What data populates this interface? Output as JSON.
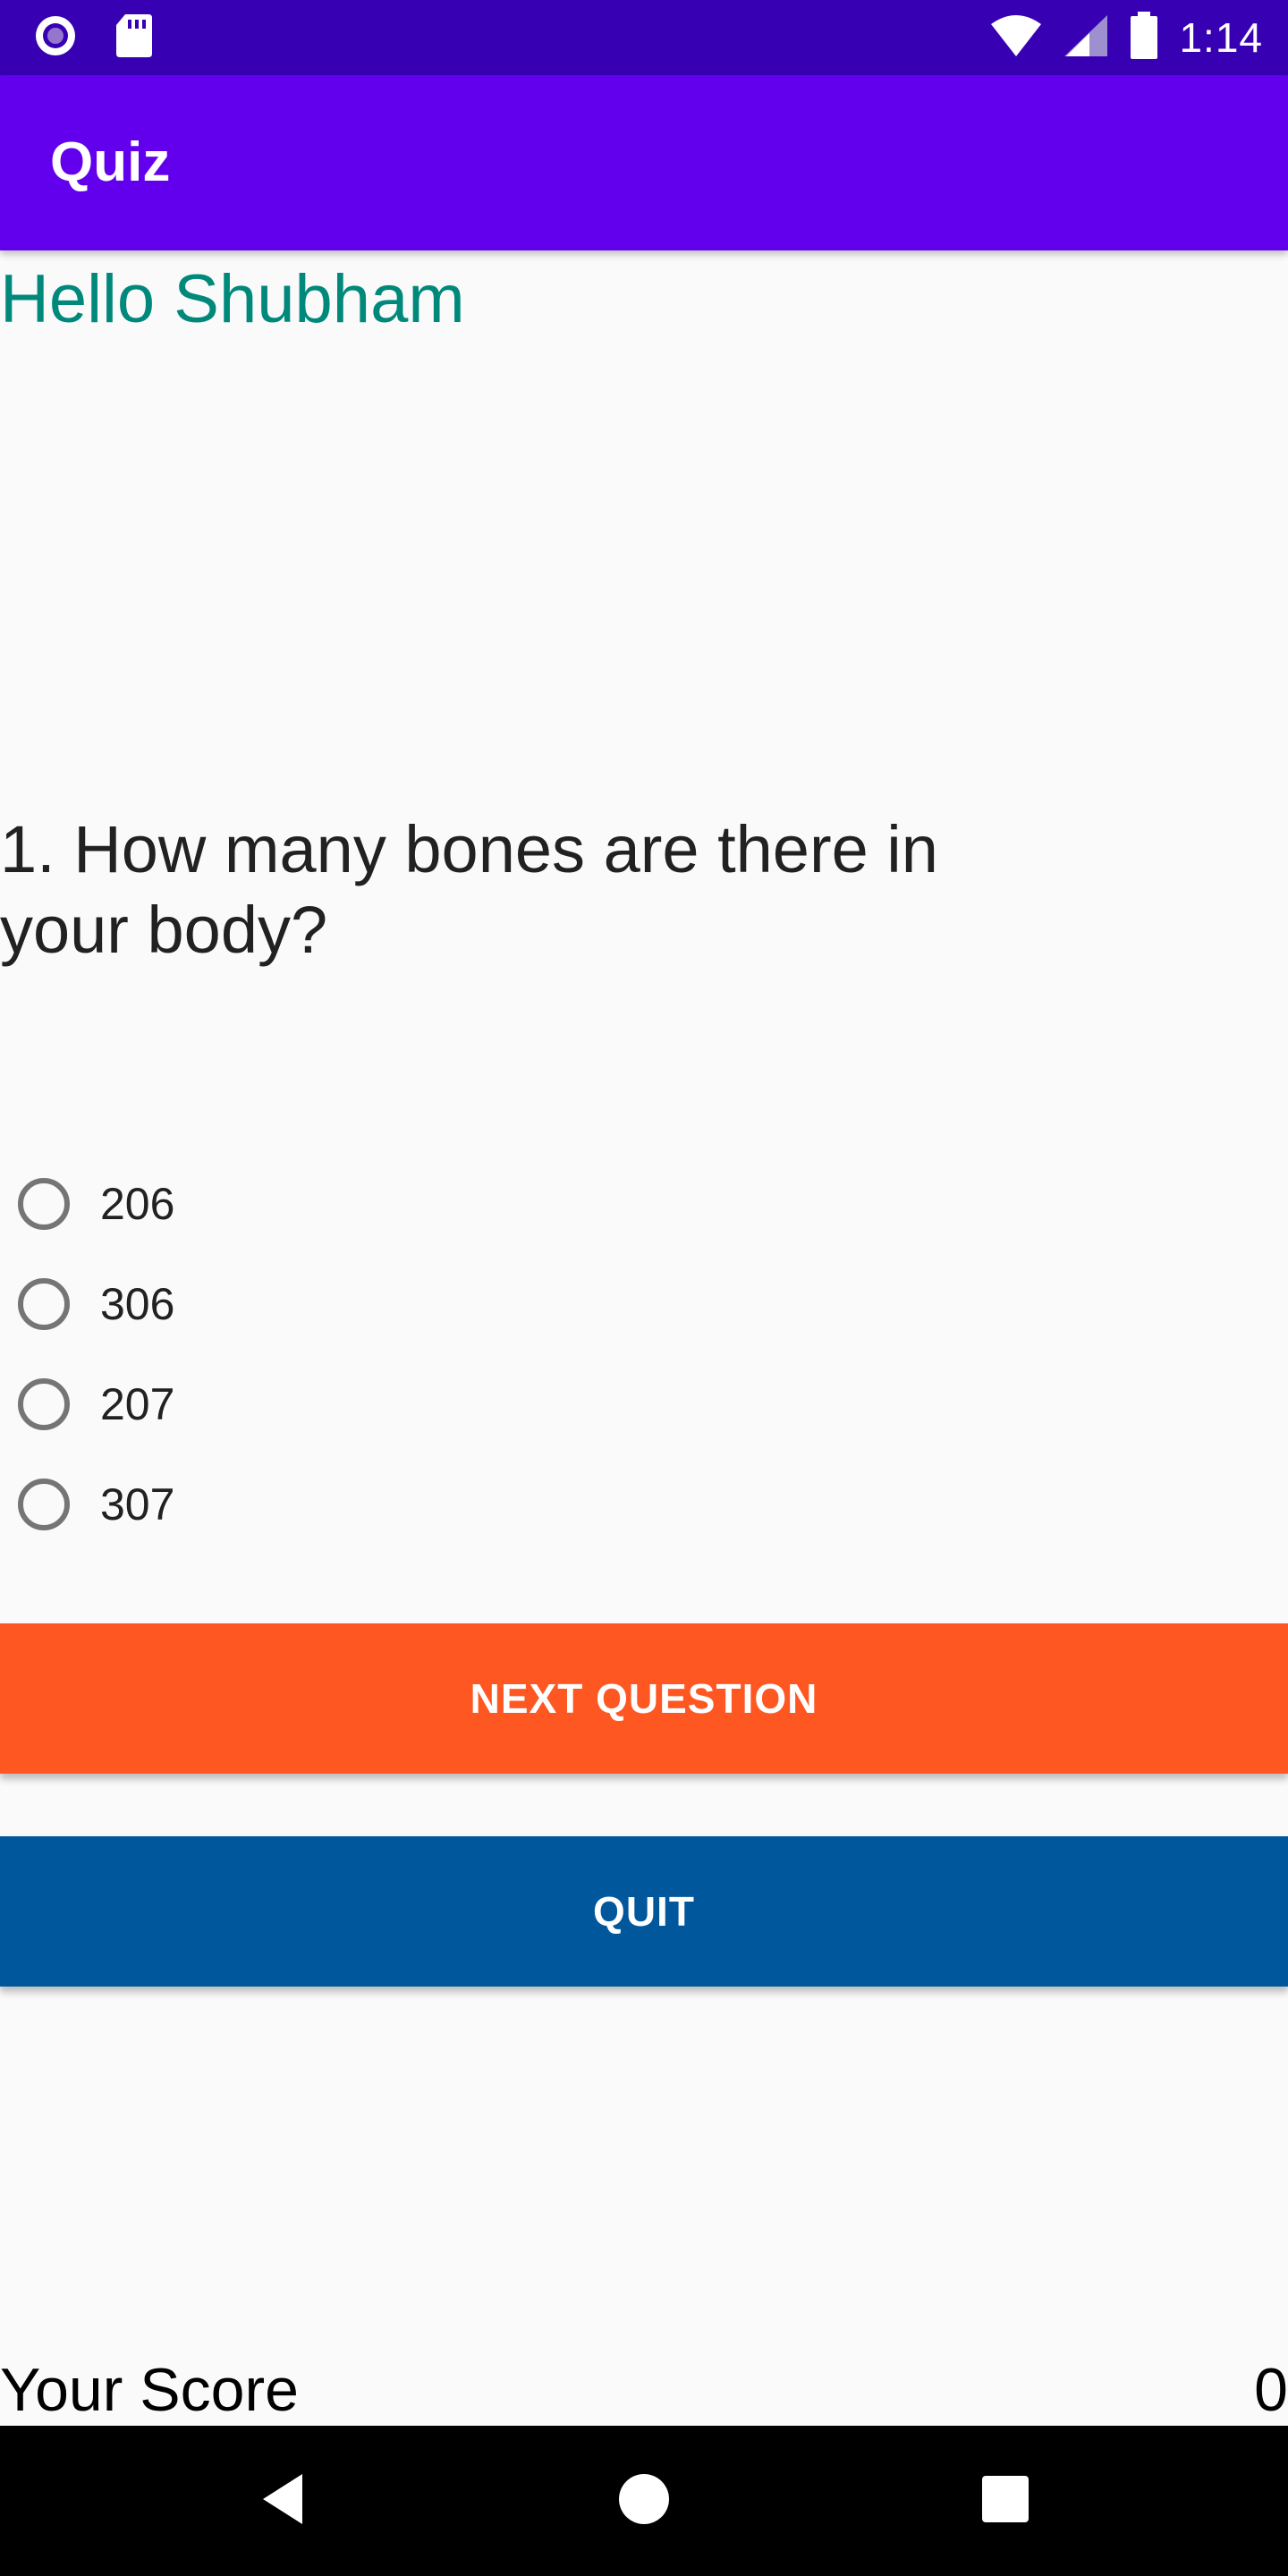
{
  "status_bar": {
    "time": "1:14",
    "left_icons": [
      "record-indicator-icon",
      "sd-card-icon"
    ],
    "right_icons": [
      "wifi-icon",
      "cell-signal-icon",
      "battery-icon"
    ]
  },
  "app_bar": {
    "title": "Quiz"
  },
  "greeting": "Hello Shubham",
  "question": "1. How many bones are there in your body?",
  "options": [
    {
      "label": "206",
      "selected": false
    },
    {
      "label": "306",
      "selected": false
    },
    {
      "label": "207",
      "selected": false
    },
    {
      "label": "307",
      "selected": false
    }
  ],
  "buttons": {
    "next_label": "NEXT QUESTION",
    "quit_label": "QUIT"
  },
  "score": {
    "label": "Your Score",
    "value": "0"
  },
  "nav_bar": {
    "icons": [
      "back-icon",
      "home-icon",
      "recents-icon"
    ]
  },
  "colors": {
    "status_bar": "#3700B3",
    "app_bar": "#6200EE",
    "greeting": "#00897B",
    "next_button": "#FF5722",
    "quit_button": "#01579B"
  }
}
